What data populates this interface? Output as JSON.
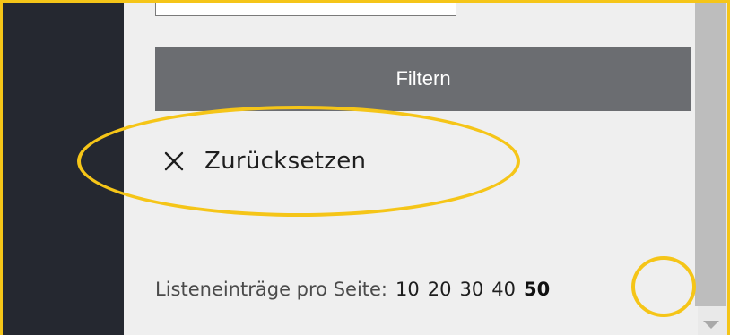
{
  "filter": {
    "search_value": "",
    "button_label": "Filtern",
    "reset_label": "Zurücksetzen"
  },
  "pagination": {
    "label": "Listeneinträge pro Seite:",
    "options": [
      "10",
      "20",
      "30",
      "40",
      "50"
    ],
    "selected": "50"
  },
  "icons": {
    "reset": "close-icon",
    "scroll_down": "chevron-down-icon"
  },
  "colors": {
    "sidebar": "#252830",
    "panel": "#efefef",
    "button": "#6b6d71",
    "highlight": "#f5c518"
  }
}
